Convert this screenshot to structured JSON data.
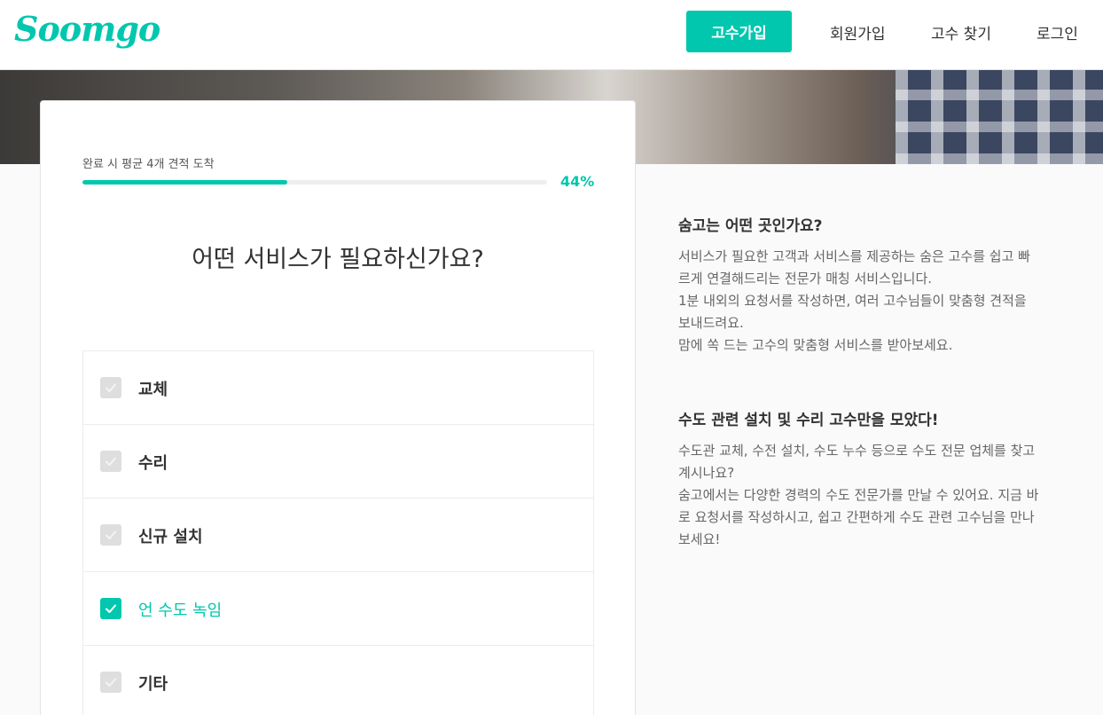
{
  "header": {
    "logo": "Soomgo",
    "pro_signup": "고수가입",
    "signup": "회원가입",
    "find_pro": "고수 찾기",
    "login": "로그인"
  },
  "progress": {
    "label": "완료 시 평균 4개 견적 도착",
    "percent_text": "44%",
    "value": 0.44
  },
  "question": "어떤 서비스가 필요하신가요?",
  "options": [
    {
      "label": "교체",
      "checked": false
    },
    {
      "label": "수리",
      "checked": false
    },
    {
      "label": "신규 설치",
      "checked": false
    },
    {
      "label": "언 수도 녹임",
      "checked": true
    },
    {
      "label": "기타",
      "checked": false
    }
  ],
  "side": {
    "about_title": "숨고는 어떤 곳인가요?",
    "about_text": [
      "서비스가 필요한 고객과 서비스를 제공하는 숨은 고수를 쉽고 빠",
      "르게 연결해드리는 전문가 매칭 서비스입니다.",
      "1분 내외의 요청서를 작성하면, 여러 고수님들이 맞춤형 견적을",
      "보내드려요.",
      "맘에 쏙 드는 고수의 맞춤형 서비스를 받아보세요."
    ],
    "plumb_title": "수도 관련 설치 및 수리 고수만을 모았다!",
    "plumb_text": [
      "수도관 교체, 수전 설치, 수도 누수 등으로 수도 전문 업체를 찾고",
      "계시나요?",
      "숨고에서는 다양한 경력의 수도 전문가를 만날 수 있어요. 지금 바",
      "로 요청서를 작성하시고, 쉽고 간편하게 수도 관련 고수님을 만나",
      "보세요!"
    ]
  },
  "colors": {
    "accent": "#00c7ae",
    "text": "#323232",
    "muted": "#666666"
  }
}
